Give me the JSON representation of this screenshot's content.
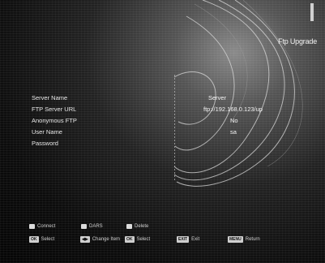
{
  "header": {
    "title": "Ftp Upgrade"
  },
  "form": {
    "rows": [
      {
        "label": "Server Name",
        "value": "Server"
      },
      {
        "label": "FTP Server URL",
        "value": "ftp://192.168.0.123/up"
      },
      {
        "label": "Anonymous FTP",
        "value": "No"
      },
      {
        "label": "User Name",
        "value": "sa"
      },
      {
        "label": "Password",
        "value": ""
      }
    ]
  },
  "footer": {
    "row1": [
      {
        "label": "Connect",
        "icon": "red-square-icon"
      },
      {
        "label": "DARS",
        "icon": "green-square-icon"
      },
      {
        "label": "Delete",
        "icon": "yellow-square-icon"
      }
    ],
    "row2": [
      {
        "key": "OK",
        "label": "Select"
      },
      {
        "key": "◀▶",
        "label": "Change Item"
      },
      {
        "key": "OK",
        "label": "Select"
      },
      {
        "key": "EXIT",
        "label": "Exit"
      },
      {
        "key": "MENU",
        "label": "Return"
      }
    ]
  }
}
